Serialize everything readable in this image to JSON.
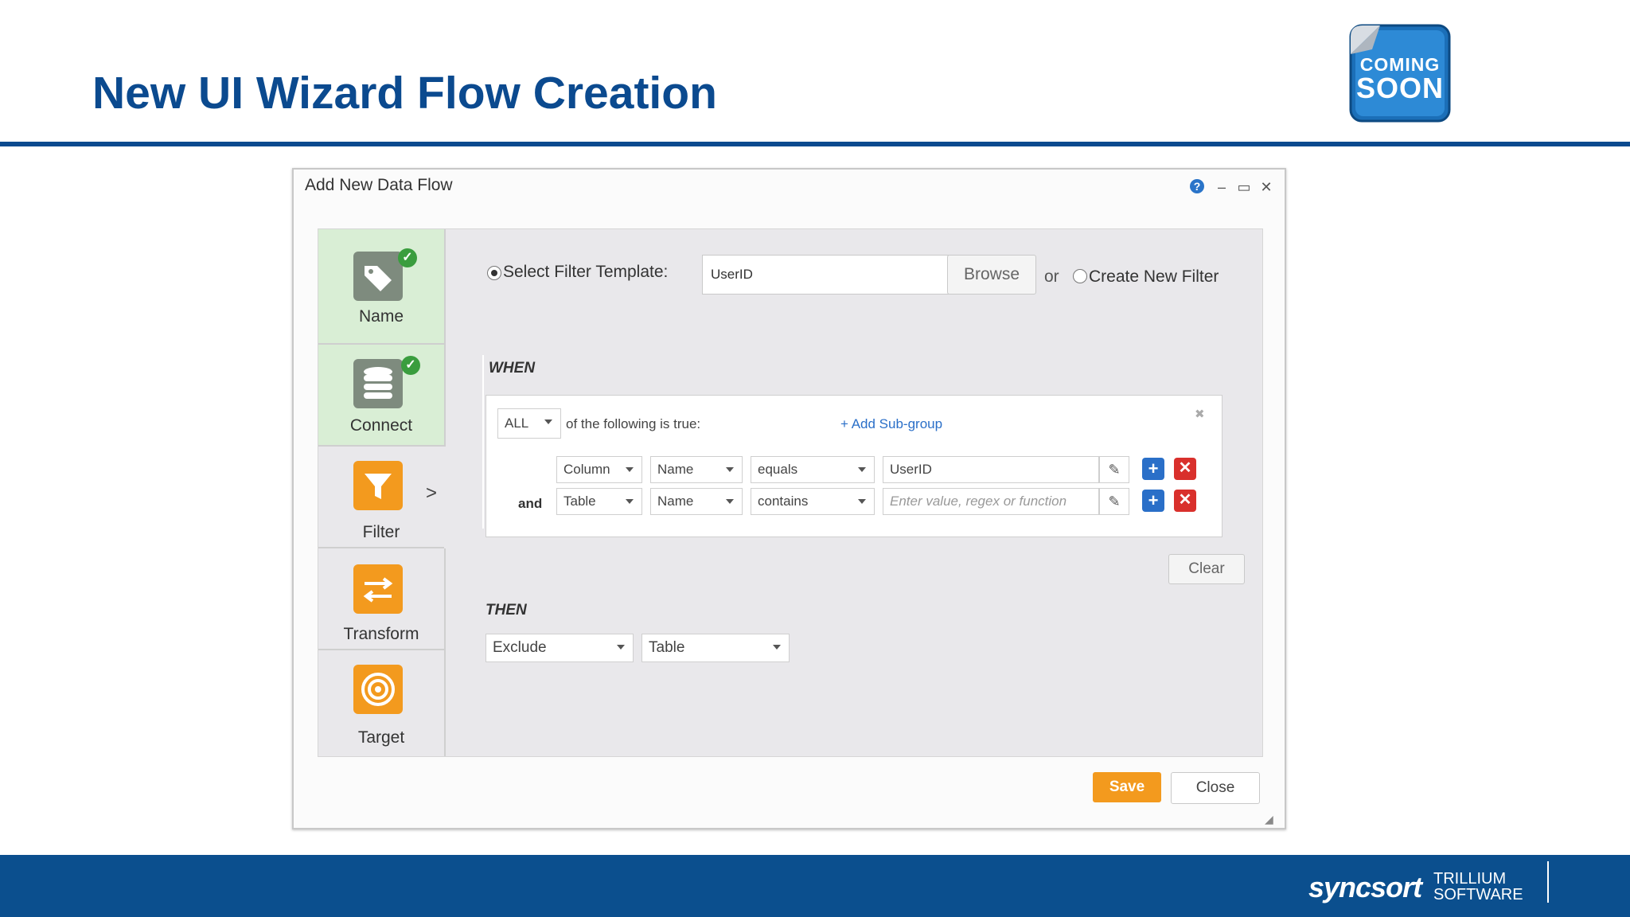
{
  "slide": {
    "title": "New UI Wizard Flow Creation",
    "badge_line1": "COMING",
    "badge_line2": "SOON"
  },
  "footer": {
    "brand": "syncsort",
    "brand2_line1": "TRILLIUM",
    "brand2_line2": "SOFTWARE"
  },
  "dialog": {
    "title": "Add New Data Flow",
    "help_icon": "?",
    "minimize_icon": "‒",
    "maximize_icon": "▭",
    "close_icon": "✕"
  },
  "steps": [
    {
      "label": "Name",
      "icon": "tag-icon",
      "done": true
    },
    {
      "label": "Connect",
      "icon": "database-icon",
      "done": true
    },
    {
      "label": "Filter",
      "icon": "filter-icon",
      "active": true
    },
    {
      "label": "Transform",
      "icon": "transform-icon"
    },
    {
      "label": "Target",
      "icon": "target-icon"
    }
  ],
  "current_step_marker": ">",
  "filter": {
    "select_template_label": "Select Filter Template:",
    "template_value": "UserID",
    "browse_label": "Browse",
    "or_label": "or",
    "create_new_label": "Create New Filter"
  },
  "when": {
    "heading": "WHEN",
    "quantifier": "ALL",
    "following_text": "of the following is true:",
    "add_subgroup": "+ Add Sub-group",
    "close_icon": "✖",
    "conditions": [
      {
        "conj": "",
        "source": "Column",
        "field": "Name",
        "operator": "equals",
        "value": "UserID",
        "placeholder": ""
      },
      {
        "conj": "and",
        "source": "Table",
        "field": "Name",
        "operator": "contains",
        "value": "",
        "placeholder": "Enter value, regex or function"
      }
    ],
    "clear_label": "Clear"
  },
  "then": {
    "heading": "THEN",
    "action": "Exclude",
    "target": "Table"
  },
  "actions": {
    "save_label": "Save",
    "close_label": "Close"
  },
  "colors": {
    "title_blue": "#0b4a8f",
    "footer_blue": "#0b4f8e",
    "step_done_green": "#d9eed5",
    "step_orange": "#f39a1e",
    "save_orange": "#f39a1e"
  }
}
